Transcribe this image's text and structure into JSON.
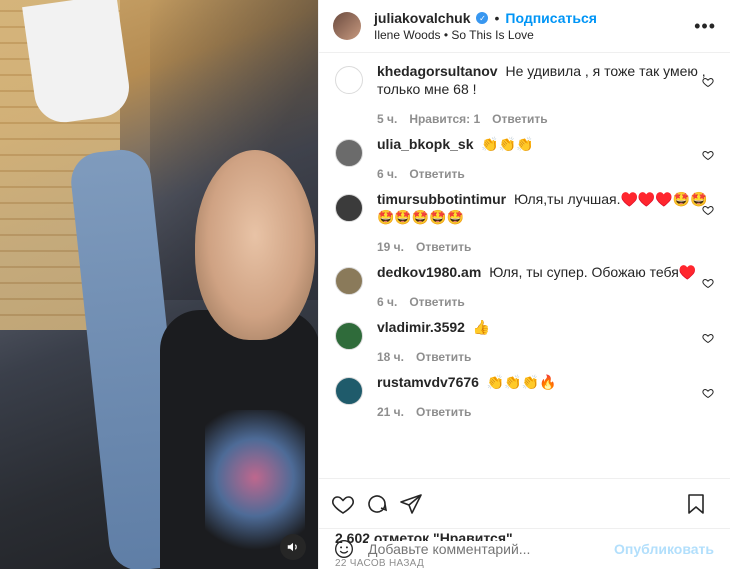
{
  "post": {
    "username": "juliakovalchuk",
    "follow_label": "Подписаться",
    "dot": "•",
    "subtitle": "Ilene Woods • So This Is Love",
    "more_label": "•••"
  },
  "comments": [
    {
      "user": "khedagorsultanov",
      "text": "Не удивила , я тоже так умею , только мне 68 !",
      "time": "5 ч.",
      "likes": "Нравится: 1",
      "reply": "Ответить",
      "color": "#ffffff"
    },
    {
      "user": "ulia_bkopk_sk",
      "text": "👏👏👏",
      "time": "6 ч.",
      "likes": "",
      "reply": "Ответить",
      "color": "#6b6b6b"
    },
    {
      "user": "timursubbotintimur",
      "text": "Юля,ты лучшая.♥️♥️♥️🤩🤩🤩🤩🤩🤩🤩",
      "time": "19 ч.",
      "likes": "",
      "reply": "Ответить",
      "color": "#3b3b3b"
    },
    {
      "user": "dedkov1980.am",
      "text": "Юля, ты супер. Обожаю тебя♥️",
      "time": "6 ч.",
      "likes": "",
      "reply": "Ответить",
      "color": "#8a7a5a"
    },
    {
      "user": "vladimir.3592",
      "text": "👍",
      "time": "18 ч.",
      "likes": "",
      "reply": "Ответить",
      "color": "#2f6b3a"
    },
    {
      "user": "rustamvdv7676",
      "text": "👏👏👏🔥",
      "time": "21 ч.",
      "likes": "",
      "reply": "Ответить",
      "color": "#1f5b6b"
    }
  ],
  "footer": {
    "likes": "2 602 отметок \"Нравится\"",
    "age": "22 ЧАСОВ НАЗАД",
    "comment_placeholder": "Добавьте комментарий...",
    "publish_label": "Опубликовать"
  },
  "colors": {
    "accent": "#0095f6",
    "publish_disabled": "#b2dffc",
    "meta": "#8e8e8e"
  }
}
